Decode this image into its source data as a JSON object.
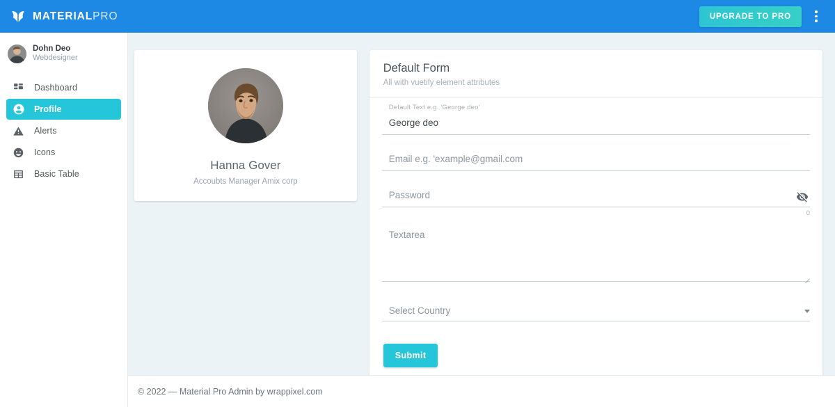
{
  "colors": {
    "header_bg": "#1e88e5",
    "accent_cyan": "#26c6da",
    "page_bg": "#ecf3f7",
    "card_bg": "#ffffff"
  },
  "topbar": {
    "logo_icon": "butterfly-logo-icon",
    "brand_bold": "MATERIAL",
    "brand_light": "PRO",
    "upgrade_label": "UPGRADE TO PRO",
    "menu_icon": "dots-vertical-icon"
  },
  "sidebar": {
    "user": {
      "name": "Dohn Deo",
      "role": "Webdesigner",
      "avatar_icon": "avatar"
    },
    "items": [
      {
        "label": "Dashboard",
        "icon": "dashboard-grid-icon",
        "active": false
      },
      {
        "label": "Profile",
        "icon": "account-circle-icon",
        "active": true
      },
      {
        "label": "Alerts",
        "icon": "alert-triangle-icon",
        "active": false
      },
      {
        "label": "Icons",
        "icon": "emoticon-icon",
        "active": false
      },
      {
        "label": "Basic Table",
        "icon": "table-grid-icon",
        "active": false
      }
    ]
  },
  "profile_card": {
    "photo_icon": "profile-photo",
    "name": "Hanna Gover",
    "role": "Accoubts Manager Amix corp"
  },
  "form_card": {
    "title": "Default Form",
    "subtitle": "All with vuetify element attributes",
    "fields": {
      "default_text": {
        "float_label": "Default Text e.g. 'George deo'",
        "value": "George deo"
      },
      "email": {
        "placeholder": "Email e.g. 'example@gmail.com",
        "value": ""
      },
      "password": {
        "placeholder": "Password",
        "value": "",
        "toggle_icon": "eye-off-icon",
        "counter": "0"
      },
      "textarea": {
        "placeholder": "Textarea",
        "value": ""
      },
      "select_country": {
        "value": "Select Country",
        "caret_icon": "chevron-down-icon"
      }
    },
    "submit_label": "Submit"
  },
  "footer": {
    "text": "© 2022 — Material Pro Admin by wrappixel.com"
  }
}
